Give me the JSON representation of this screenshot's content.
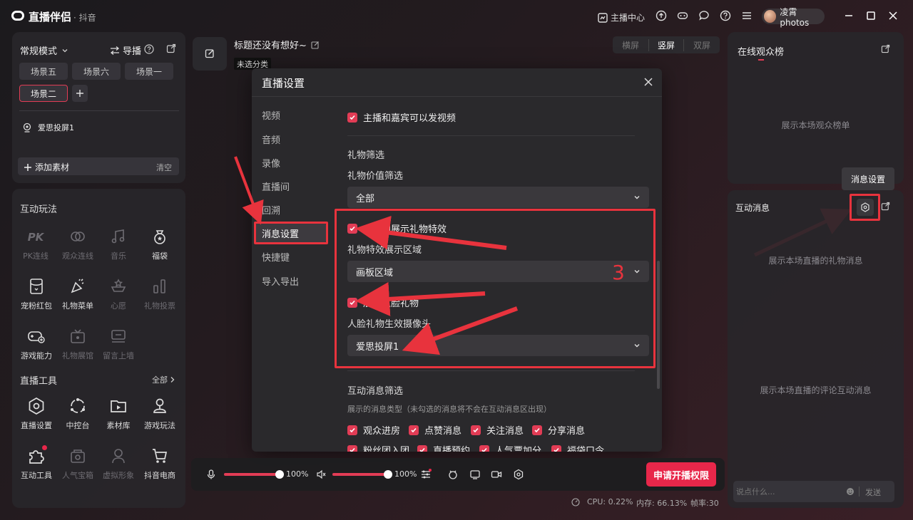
{
  "titlebar": {
    "app_name": "直播伴侣",
    "app_sub": "· 抖音",
    "anchor_center": "主播中心",
    "username": "凌霄photos"
  },
  "left_top": {
    "mode": "常规模式",
    "director": "导播",
    "scenes": [
      "场景五",
      "场景六",
      "场景一"
    ],
    "active_scene": "场景二",
    "source_name": "爱思投屏1",
    "add_material": "添加素材",
    "clear": "清空"
  },
  "interactive": {
    "title": "互动玩法",
    "items": [
      {
        "label": "PK连线",
        "icon": "pk-icon",
        "enabled": false
      },
      {
        "label": "观众连线",
        "icon": "audience-link-icon",
        "enabled": false
      },
      {
        "label": "音乐",
        "icon": "music-icon",
        "enabled": false
      },
      {
        "label": "福袋",
        "icon": "lucky-bag-icon",
        "enabled": true
      },
      {
        "label": "宠粉红包",
        "icon": "red-packet-icon",
        "enabled": true
      },
      {
        "label": "礼物菜单",
        "icon": "gift-menu-icon",
        "enabled": true
      },
      {
        "label": "心愿",
        "icon": "wish-icon",
        "enabled": false
      },
      {
        "label": "礼物投票",
        "icon": "gift-vote-icon",
        "enabled": false
      },
      {
        "label": "游戏能力",
        "icon": "game-ability-icon",
        "enabled": true
      },
      {
        "label": "礼物展馆",
        "icon": "gift-hall-icon",
        "enabled": false
      },
      {
        "label": "留言上墙",
        "icon": "message-wall-icon",
        "enabled": false
      }
    ]
  },
  "tools": {
    "title": "直播工具",
    "all": "全部",
    "items": [
      {
        "label": "直播设置",
        "icon": "live-settings-icon",
        "enabled": true
      },
      {
        "label": "中控台",
        "icon": "control-panel-icon",
        "enabled": true
      },
      {
        "label": "素材库",
        "icon": "material-library-icon",
        "enabled": true
      },
      {
        "label": "游戏玩法",
        "icon": "game-play-icon",
        "enabled": true
      },
      {
        "label": "互动工具",
        "icon": "interactive-tools-icon",
        "enabled": true
      },
      {
        "label": "人气宝箱",
        "icon": "popularity-box-icon",
        "enabled": false
      },
      {
        "label": "虚拟形象",
        "icon": "avatar-figure-icon",
        "enabled": false
      },
      {
        "label": "抖音电商",
        "icon": "ecommerce-cart-icon",
        "enabled": true
      }
    ]
  },
  "stream_header": {
    "title": "标题还没有想好~",
    "category": "未选分类",
    "orientations": [
      "横屏",
      "竖屏",
      "双屏"
    ]
  },
  "modal": {
    "title": "直播设置",
    "nav": [
      "视频",
      "音频",
      "录像",
      "直播间",
      "回溯",
      "消息设置",
      "快捷键",
      "导入导出"
    ],
    "active_nav": "消息设置",
    "video_guest": "主播和嘉宾可以发视频",
    "gift_filter_title": "礼物筛选",
    "gift_value_label": "礼物价值筛选",
    "gift_value_value": "全部",
    "show_effects": "主播侧展示礼物特效",
    "effects_area_label": "礼物特效展示区域",
    "effects_area_value": "画板区域",
    "face_gift": "展示人脸礼物",
    "face_camera_label": "人脸礼物生效摄像头",
    "face_camera_value": "爱思投屏1",
    "interactive_filter_title": "互动消息筛选",
    "interactive_filter_desc": "展示的消息类型（未勾选的消息将不会在互动消息区出现）",
    "msg_types": [
      "观众进房",
      "点赞消息",
      "关注消息",
      "分享消息"
    ],
    "msg_types_row2": [
      "粉丝团入团",
      "直播预约",
      "人气票加分",
      "福袋口令"
    ]
  },
  "annotation": {
    "number": "3"
  },
  "bottom_bar": {
    "mic_volume": "100%",
    "speaker_volume": "100%",
    "apply_button": "申请开播权限"
  },
  "status": {
    "cpu": "CPU: 0.22%",
    "memory": "内存: 66.13%",
    "fps": "帧率:30"
  },
  "right": {
    "viewers_title": "在线观众榜",
    "viewers_empty": "展示本场观众榜单",
    "tooltip": "消息设置",
    "messages_title": "互动消息",
    "gift_empty": "展示本场直播的礼物消息",
    "comment_empty": "展示本场直播的评论互动消息",
    "input_placeholder": "说点什么...",
    "send": "发送"
  },
  "colors": {
    "accent": "#e23c55",
    "annotation_red": "#e8333d"
  }
}
